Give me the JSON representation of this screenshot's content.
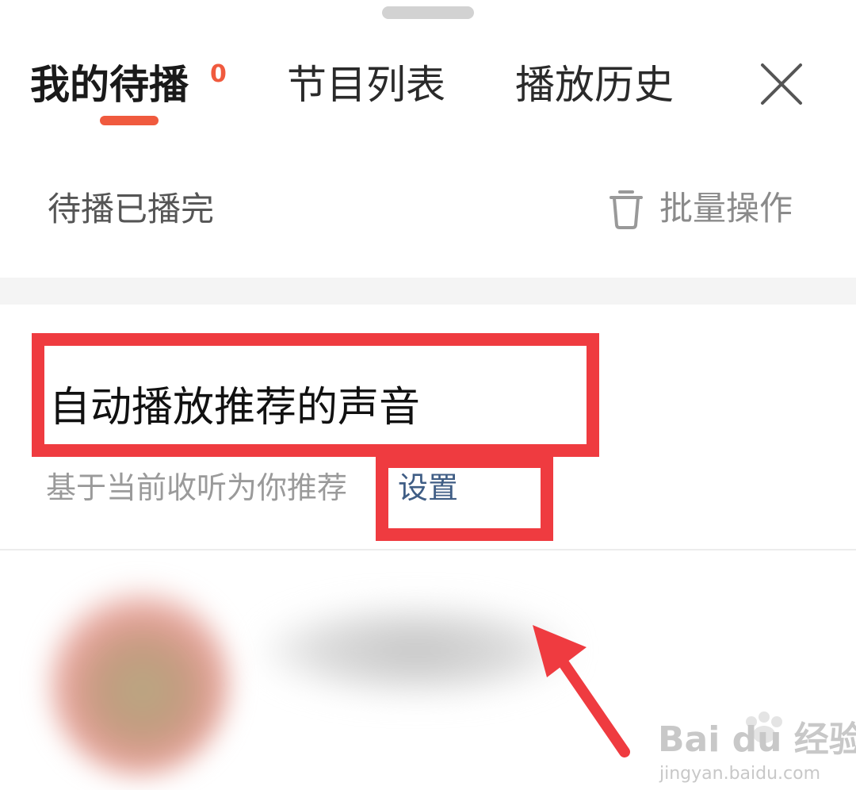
{
  "tabs": [
    {
      "label": "我的待播",
      "active": true,
      "badge": "0"
    },
    {
      "label": "节目列表",
      "active": false
    },
    {
      "label": "播放历史",
      "active": false
    }
  ],
  "subheader": {
    "left_label": "待播已播完",
    "batch_label": "批量操作",
    "batch_icon": "trash-icon"
  },
  "recommend": {
    "title": "自动播放推荐的声音",
    "description": "基于当前收听为你推荐",
    "setting_link": "设置"
  },
  "watermark": {
    "brand": "Bai du 经验",
    "url": "jingyan.baidu.com"
  },
  "colors": {
    "accent": "#f05a3e",
    "highlight": "#ef3b40",
    "link": "#3f5d85"
  }
}
